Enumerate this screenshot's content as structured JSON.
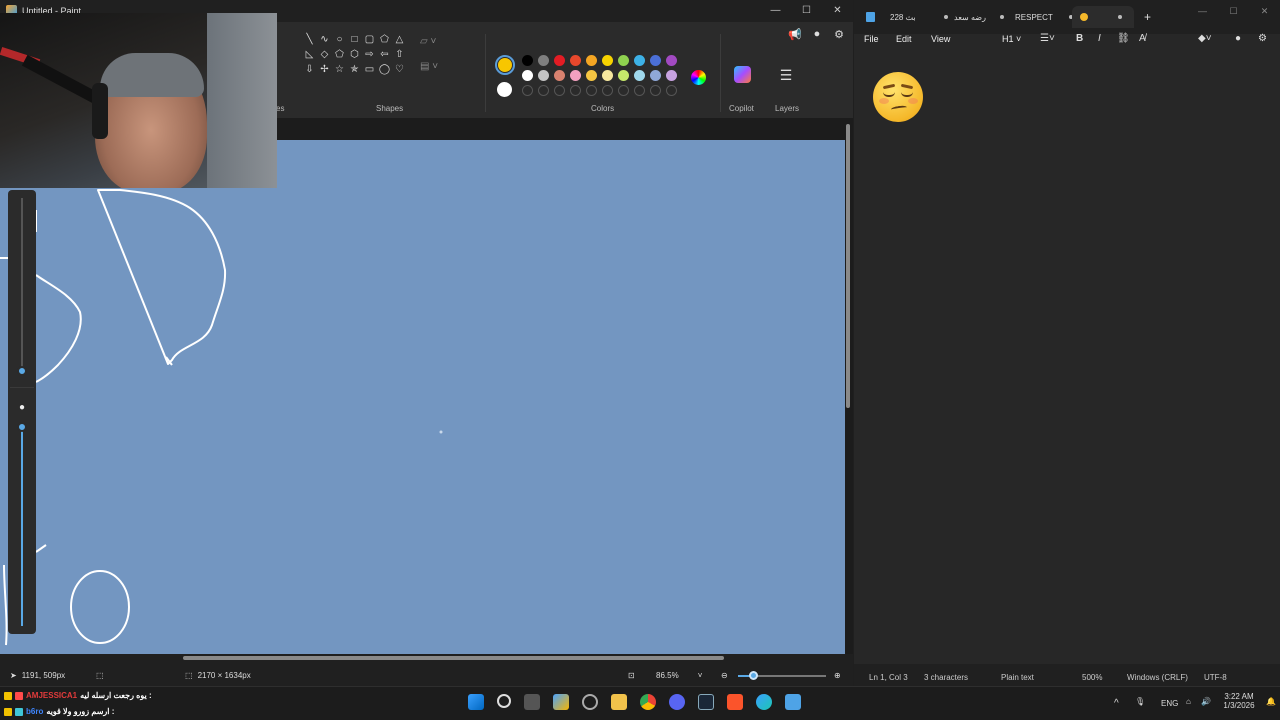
{
  "paint": {
    "title": "Untitled - Paint",
    "window_controls": {
      "minimize": "—",
      "maximize": "☐",
      "close": "✕"
    },
    "ribbon": {
      "groups": {
        "left_cut_label": "es",
        "shapes": "Shapes",
        "colors": "Colors",
        "copilot": "Copilot",
        "layers": "Layers"
      },
      "shapes": [
        "╲",
        "∿",
        "○",
        "□",
        "▢",
        "⬠",
        "△",
        "◺",
        "◇",
        "⬠",
        "⬡",
        "⇨",
        "⇦",
        "⇧",
        "⇩",
        "✢",
        "☆",
        "✯",
        "▭",
        "◯",
        "♡"
      ],
      "primary_color": "#f7c600",
      "secondary_color": "#ffffff",
      "palette_row1": [
        "#000000",
        "#7f7f7f",
        "#e31c24",
        "#e8482c",
        "#f5a623",
        "#f7d300",
        "#8fd14f",
        "#3db1e6",
        "#4b6fd6",
        "#a24ac2"
      ],
      "palette_row2": [
        "#ffffff",
        "#c3c3c3",
        "#d9826f",
        "#f4a1c0",
        "#f5c542",
        "#f5e79e",
        "#c6e86b",
        "#9fd8ec",
        "#8fa8d8",
        "#c7a2e0"
      ]
    },
    "canvas_color": "#7396c1",
    "status": {
      "cursor_pos": "1191, 509px",
      "canvas_size": "2170 × 1634px",
      "zoom": "86.5%"
    }
  },
  "notepad": {
    "tabs": [
      {
        "label": "228 بث",
        "active": false
      },
      {
        "label": "رضه سعد",
        "active": false
      },
      {
        "label": "RESPECT",
        "active": false
      },
      {
        "label": "",
        "active": true
      }
    ],
    "menu": {
      "file": "File",
      "edit": "Edit",
      "view": "View",
      "heading": "H1"
    },
    "status": {
      "position": "Ln 1, Col 3",
      "characters": "3 characters",
      "format": "Plain text",
      "zoom": "500%",
      "line_ending": "Windows (CRLF)",
      "encoding": "UTF-8"
    }
  },
  "taskbar": {
    "chat": [
      {
        "user": "AMJESSICA1",
        "message": "يوه رجعت ارسله ليه :"
      },
      {
        "user": "b6ro",
        "message": "ارسم زورو ولا قويه :"
      }
    ],
    "tray": {
      "language": "ENG",
      "time": "3:22 AM",
      "date": "1/3/2026"
    }
  }
}
